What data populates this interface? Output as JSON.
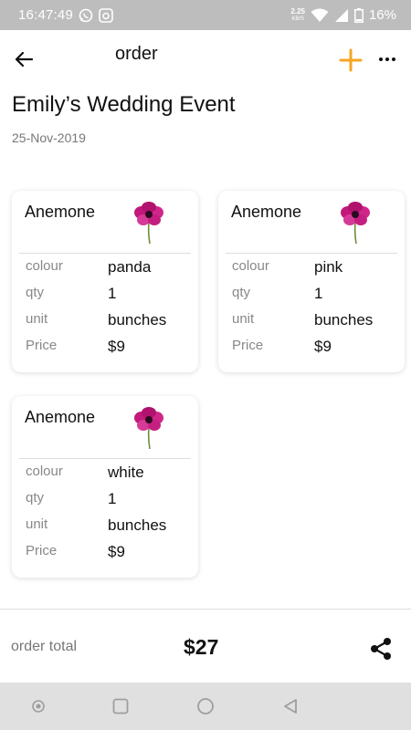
{
  "status_bar": {
    "time": "16:47:49",
    "net_speed_value": "2.25",
    "net_speed_unit": "KB/S",
    "battery": "16%"
  },
  "app_bar": {
    "title": "order",
    "back_icon": "arrow-left-icon",
    "add_icon": "plus-icon",
    "more_icon": "more-horizontal-icon",
    "accent_color": "#f5a623"
  },
  "event": {
    "title": "Emily’s Wedding Event",
    "date": "25-Nov-2019"
  },
  "items": [
    {
      "name": "Anemone",
      "image_icon": "anemone-flower-icon",
      "colour_label": "colour",
      "colour": "panda",
      "qty_label": "qty",
      "qty": "1",
      "unit_label": "unit",
      "unit": "bunches",
      "price_label": "Price",
      "price": "$9"
    },
    {
      "name": "Anemone",
      "image_icon": "anemone-flower-icon",
      "colour_label": "colour",
      "colour": "pink",
      "qty_label": "qty",
      "qty": "1",
      "unit_label": "unit",
      "unit": "bunches",
      "price_label": "Price",
      "price": "$9"
    },
    {
      "name": "Anemone",
      "image_icon": "anemone-flower-icon",
      "colour_label": "colour",
      "colour": "white",
      "qty_label": "qty",
      "qty": "1",
      "unit_label": "unit",
      "unit": "bunches",
      "price_label": "Price",
      "price": "$9"
    }
  ],
  "footer": {
    "total_label": "order total",
    "total_value": "$27",
    "share_icon": "share-icon"
  },
  "nav_bar": {
    "icons": [
      "dot-icon",
      "recents-square-icon",
      "home-circle-icon",
      "back-triangle-icon"
    ]
  }
}
